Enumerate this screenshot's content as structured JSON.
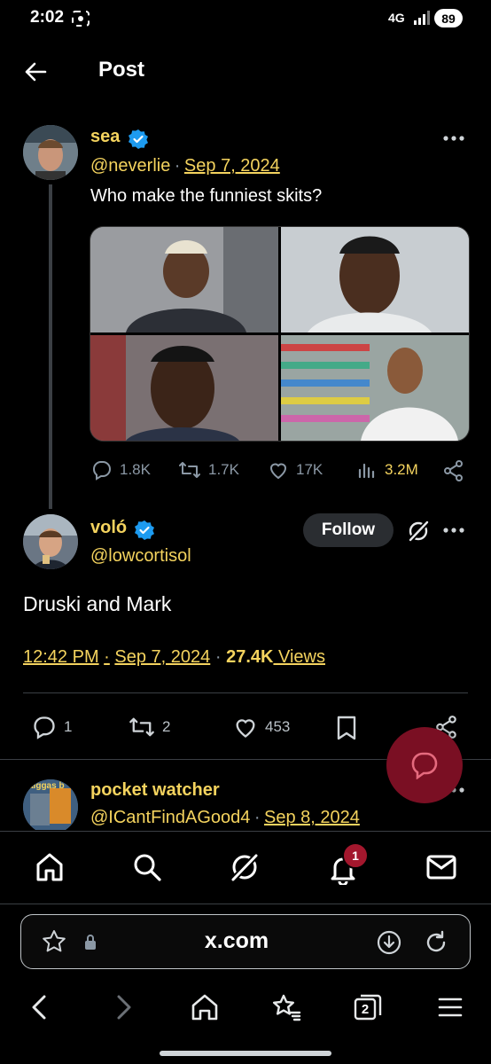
{
  "status_bar": {
    "time": "2:02",
    "network": "4G",
    "battery": "89"
  },
  "header": {
    "title": "Post"
  },
  "parent_post": {
    "display_name": "sea",
    "handle": "@neverlie",
    "separator": "·",
    "date": "Sep 7, 2024",
    "text": "Who make the funniest skits?",
    "replies": "1.8K",
    "reposts": "1.7K",
    "likes": "17K",
    "views": "3.2M"
  },
  "main_post": {
    "display_name": "voló",
    "handle": "@lowcortisol",
    "follow_label": "Follow",
    "text": "Druski and Mark",
    "time": "12:42 PM",
    "separator": "·",
    "date": "Sep 7, 2024",
    "views_count": "27.4K",
    "views_label": " Views",
    "replies": "1",
    "reposts": "2",
    "likes": "453"
  },
  "reply_post": {
    "display_name": "pocket watcher",
    "handle": "@ICantFindAGood4",
    "separator": "·",
    "date": "Sep 8, 2024",
    "avatar_text": "aiggas b"
  },
  "bottom_nav": {
    "notification_count": "1"
  },
  "browser": {
    "url": "x.com",
    "tab_count": "2"
  },
  "colors": {
    "accent": "#f4d35e",
    "verified": "#1d9bf0",
    "fab": "#7a0f23",
    "badge": "#a3172d"
  }
}
